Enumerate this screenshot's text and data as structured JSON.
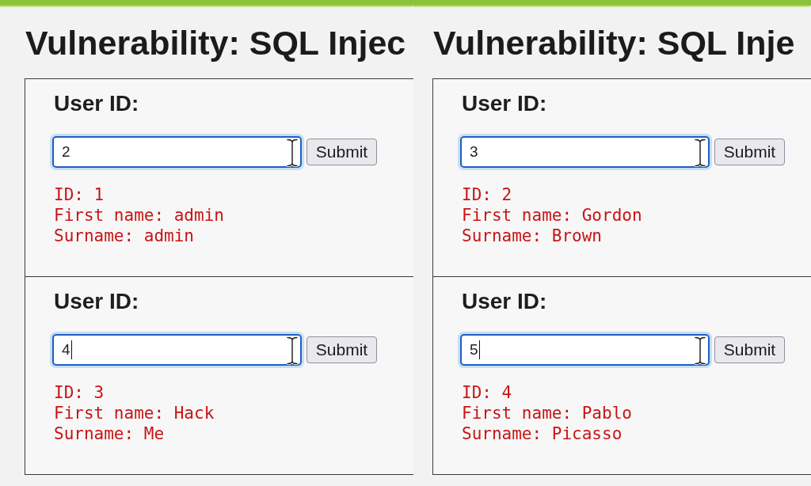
{
  "screens": [
    {
      "title": "Vulnerability: SQL Injec",
      "forms": [
        {
          "label": "User ID:",
          "input": {
            "value": "2",
            "caret": false
          },
          "button": "Submit",
          "result": [
            "ID: 1",
            "First name: admin",
            "Surname: admin"
          ]
        },
        {
          "label": "User ID:",
          "input": {
            "value": "4",
            "caret": true
          },
          "button": "Submit",
          "result": [
            "ID: 3",
            "First name: Hack",
            "Surname: Me"
          ]
        }
      ]
    },
    {
      "title": "Vulnerability: SQL Inje",
      "forms": [
        {
          "label": "User ID:",
          "input": {
            "value": "3",
            "caret": false
          },
          "button": "Submit",
          "result": [
            "ID: 2",
            "First name: Gordon",
            "Surname: Brown"
          ]
        },
        {
          "label": "User ID:",
          "input": {
            "value": "5",
            "caret": true
          },
          "button": "Submit",
          "result": [
            "ID: 4",
            "First name: Pablo",
            "Surname: Picasso"
          ]
        }
      ]
    }
  ]
}
